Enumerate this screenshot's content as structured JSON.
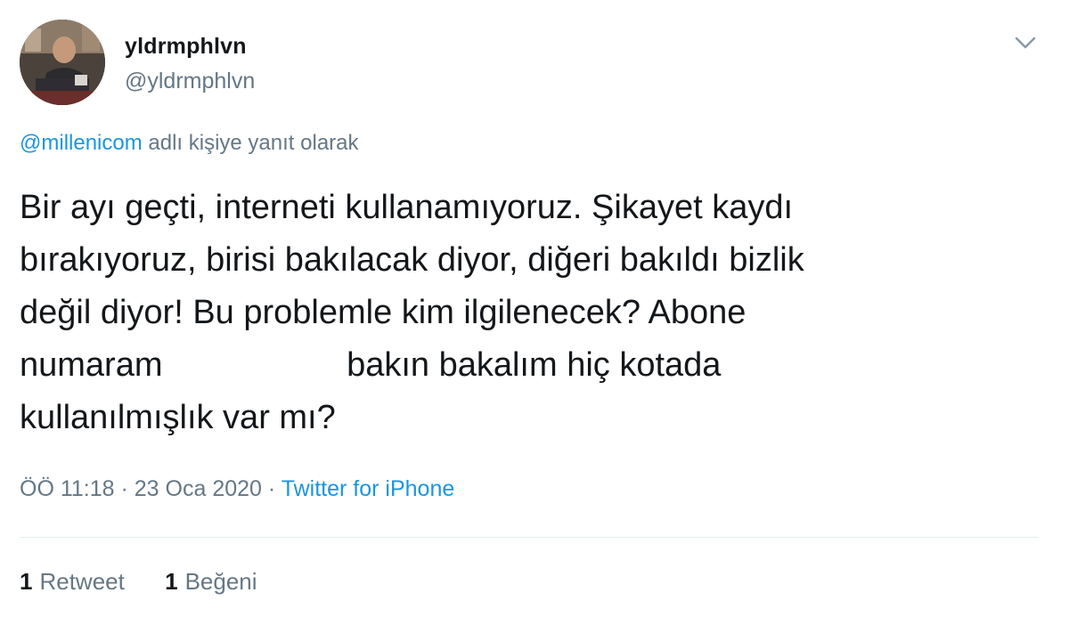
{
  "user": {
    "display_name": "yldrmphlvn",
    "handle": "@yldrmphlvn",
    "avatar_icon": "user-photo-avatar"
  },
  "reply": {
    "mention": "@millenicom",
    "suffix": "adlı kişiye yanıt olarak"
  },
  "tweet": {
    "text_part1": "Bir ayı geçti, interneti kullanamıyoruz. Şikayet kaydı\nbırakıyoruz, birisi bakılacak diyor, diğeri bakıldı bizlik\ndeğil diyor! Bu problemle kim ilgilenecek? Abone\nnumaram ",
    "text_part2": "bakın bakalım hiç kotada\nkullanılmışlık var mı?"
  },
  "meta": {
    "time": "ÖÖ 11:18",
    "separator": "·",
    "date": "23 Oca 2020",
    "source": "Twitter for iPhone"
  },
  "stats": {
    "retweets_count": "1",
    "retweets_label": "Retweet",
    "likes_count": "1",
    "likes_label": "Beğeni"
  },
  "colors": {
    "link": "#1b95e0",
    "secondary_text": "#657786",
    "primary_text": "#14171a"
  }
}
